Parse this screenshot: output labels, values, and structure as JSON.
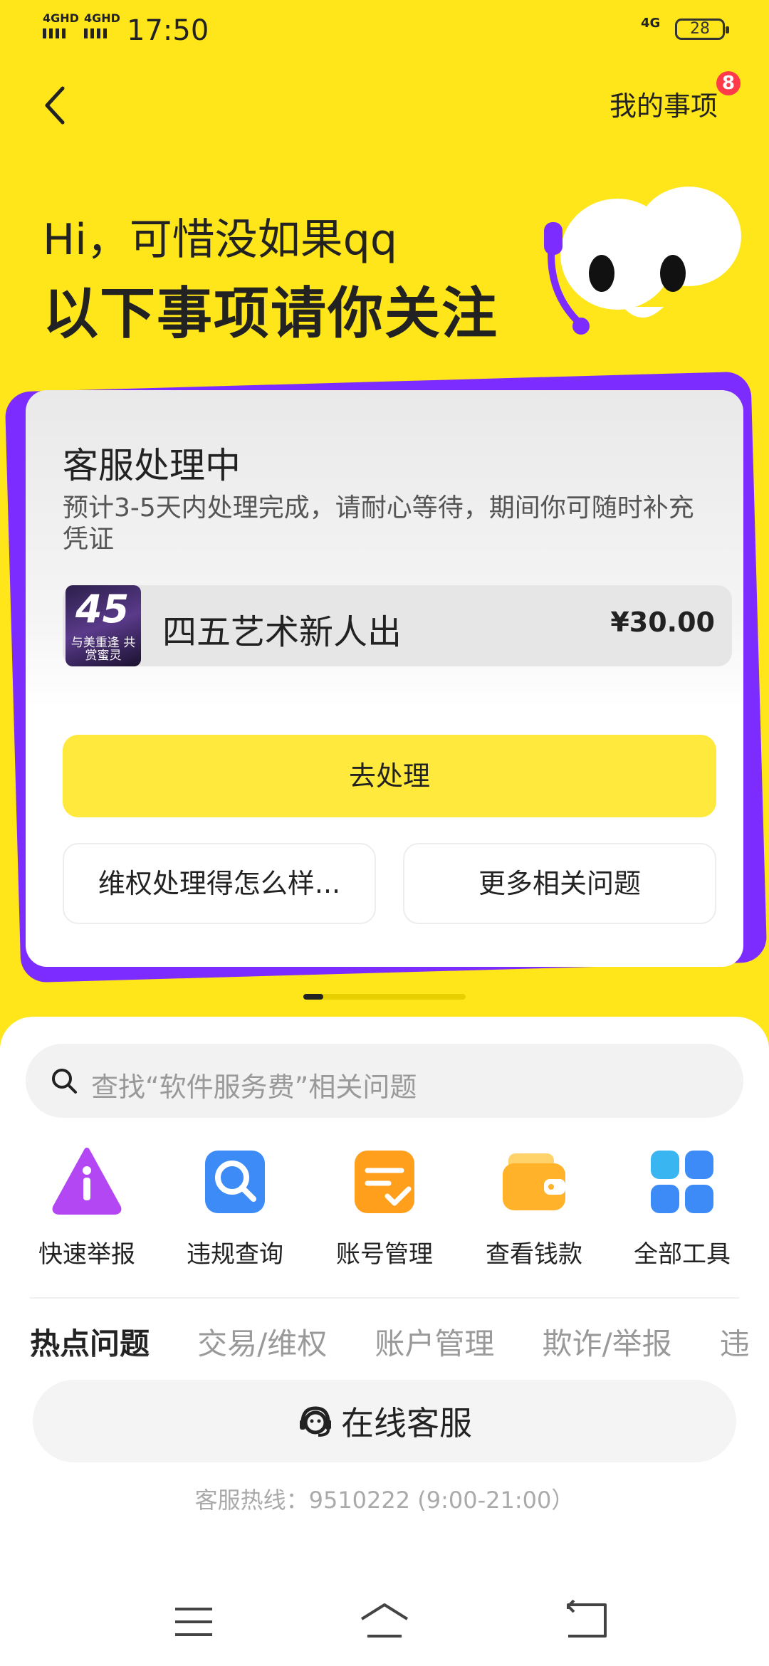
{
  "status_bar": {
    "network_1": "4GHD",
    "network_2": "4GHD",
    "time": "17:50",
    "network_right": "4G",
    "battery": "28"
  },
  "header": {
    "my_matters": "我的事项",
    "badge_count": "8"
  },
  "greeting": {
    "hi": "Hi，可惜没如果qq",
    "headline": "以下事项请你关注"
  },
  "card": {
    "title": "客服处理中",
    "description": "预计3-5天内处理完成，请耐心等待，期间你可随时补充凭证",
    "product": {
      "thumb_number": "45",
      "thumb_caption": "与美重逢 共赏蜜灵",
      "name": "四五艺术新人出",
      "price": "¥30.00"
    },
    "primary_button": "去处理",
    "secondary_buttons": [
      "维权处理得怎么样...",
      "更多相关问题"
    ]
  },
  "carousel": {
    "pages": 5,
    "active": 1
  },
  "search": {
    "placeholder": "查找“软件服务费”相关问题"
  },
  "tools": [
    {
      "label": "快速举报",
      "icon": "report-icon"
    },
    {
      "label": "违规查询",
      "icon": "search-violation-icon"
    },
    {
      "label": "账号管理",
      "icon": "account-manage-icon"
    },
    {
      "label": "查看钱款",
      "icon": "wallet-icon"
    },
    {
      "label": "全部工具",
      "icon": "grid-icon"
    }
  ],
  "tabs": [
    "热点问题",
    "交易/维权",
    "账户管理",
    "欺诈/举报",
    "违"
  ],
  "service": {
    "label": "在线客服",
    "hotline": "客服热线：9510222 (9:00-21:00）"
  },
  "colors": {
    "brand_yellow": "#ffe61a",
    "accent_purple": "#7c2cff",
    "badge_red": "#ff3b4a"
  }
}
